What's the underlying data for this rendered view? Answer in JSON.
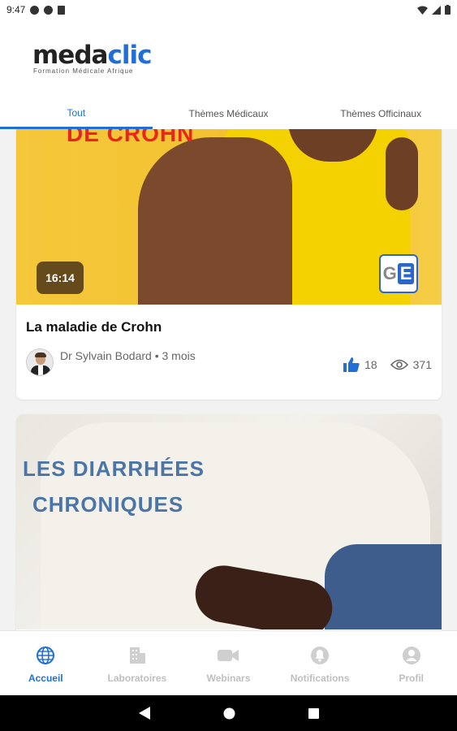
{
  "status_bar": {
    "time": "9:47"
  },
  "header": {
    "logo_part1": "meda",
    "logo_part2": "clic",
    "logo_tagline": "Formation Médicale Afrique"
  },
  "tabs": [
    {
      "label": "Tout",
      "active": true
    },
    {
      "label": "Thèmes Médicaux",
      "active": false
    },
    {
      "label": "Thèmes Officinaux",
      "active": false
    }
  ],
  "cards": [
    {
      "thumbnail_text": "DE CROHN",
      "duration": "16:14",
      "title": "La maladie de Crohn",
      "author": "Dr Sylvain  Bodard • 3 mois",
      "likes": "18",
      "views": "371"
    },
    {
      "thumbnail_line1": "LES DIARRHÉES",
      "thumbnail_line2": "CHRONIQUES"
    }
  ],
  "bottom_nav": [
    {
      "label": "Accueil",
      "icon": "globe-icon",
      "active": true
    },
    {
      "label": "Laboratoires",
      "icon": "building-icon",
      "active": false
    },
    {
      "label": "Webinars",
      "icon": "video-icon",
      "active": false
    },
    {
      "label": "Notifications",
      "icon": "bell-icon",
      "active": false
    },
    {
      "label": "Profil",
      "icon": "user-icon",
      "active": false
    }
  ],
  "colors": {
    "accent": "#1f6fd6",
    "inactive": "#bfbfbf"
  }
}
